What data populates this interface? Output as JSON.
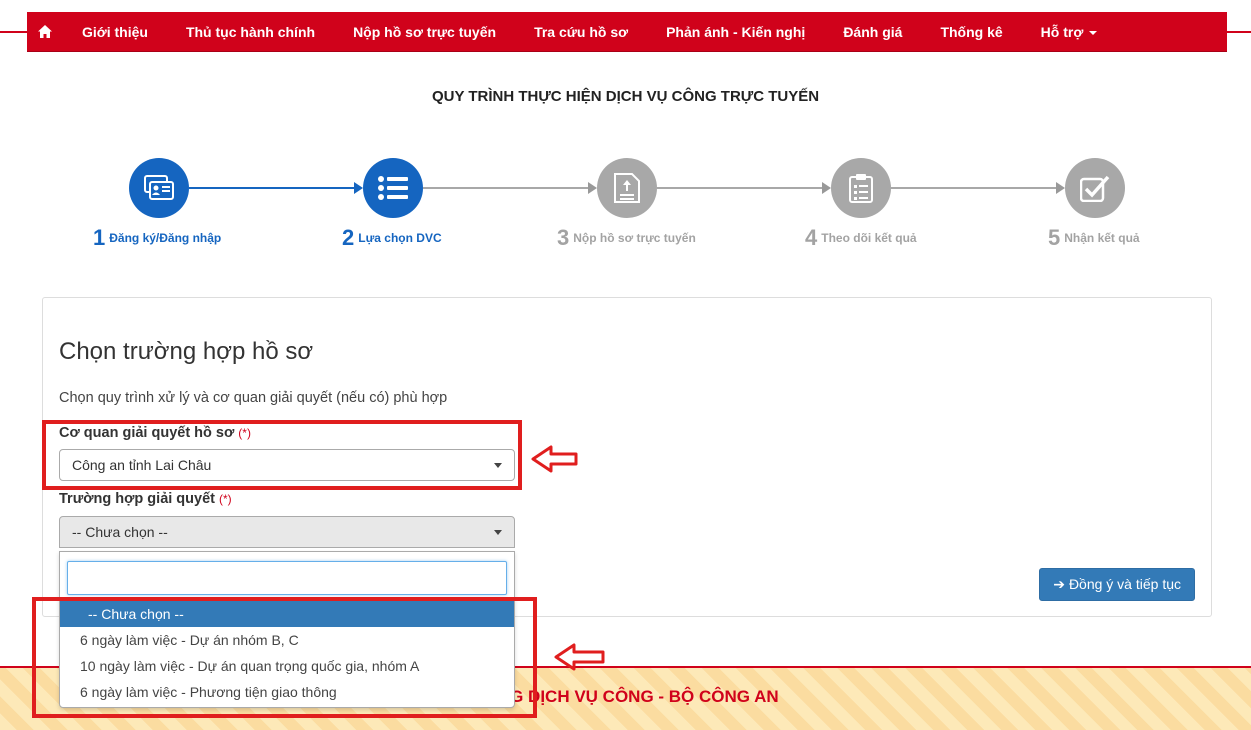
{
  "nav": {
    "home_icon": "home-icon",
    "items": [
      "Giới thiệu",
      "Thủ tục hành chính",
      "Nộp hồ sơ trực tuyến",
      "Tra cứu hồ sơ",
      "Phản ánh - Kiến nghị",
      "Đánh giá",
      "Thống kê",
      "Hỗ trợ"
    ],
    "color": "#d0021b"
  },
  "page": {
    "title": "QUY TRÌNH THỰC HIỆN DỊCH VỤ CÔNG TRỰC TUYẾN"
  },
  "steps": [
    {
      "num": "1",
      "label": "Đăng ký/Đăng nhập",
      "icon": "id-card-icon",
      "state": "active"
    },
    {
      "num": "2",
      "label": "Lựa chọn DVC",
      "icon": "list-icon",
      "state": "active"
    },
    {
      "num": "3",
      "label": "Nộp hồ sơ trực tuyến",
      "icon": "upload-document-icon",
      "state": "inactive"
    },
    {
      "num": "4",
      "label": "Theo dõi kết quả",
      "icon": "clipboard-icon",
      "state": "inactive"
    },
    {
      "num": "5",
      "label": "Nhận kết quả",
      "icon": "check-square-icon",
      "state": "inactive"
    }
  ],
  "colors": {
    "active": "#1565c0",
    "inactive": "#a3a3a3",
    "primary": "#337ab7",
    "highlight": "#e01e1e"
  },
  "form": {
    "heading": "Chọn trường hợp hồ sơ",
    "description": "Chọn quy trình xử lý và cơ quan giải quyết (nếu có) phù hợp",
    "agency_label": "Cơ quan giải quyết hồ sơ",
    "agency_value": "Công an tỉnh Lai Châu",
    "case_label": "Trường hợp giải quyết",
    "case_value": "-- Chưa chọn --",
    "required_mark": "(*)",
    "submit_label": "Đồng ý và tiếp tục",
    "submit_icon": "arrow-right-icon"
  },
  "dropdown": {
    "search_value": "",
    "options": [
      "-- Chưa chọn --",
      "6 ngày làm việc - Dự án nhóm B, C",
      "10 ngày làm việc - Dự án quan trọng quốc gia, nhóm A",
      "6 ngày làm việc - Phương tiện giao thông"
    ],
    "selected": "-- Chưa chọn --"
  },
  "footer": {
    "text": "CỔNG DỊCH VỤ CÔNG - BỘ CÔNG AN"
  }
}
